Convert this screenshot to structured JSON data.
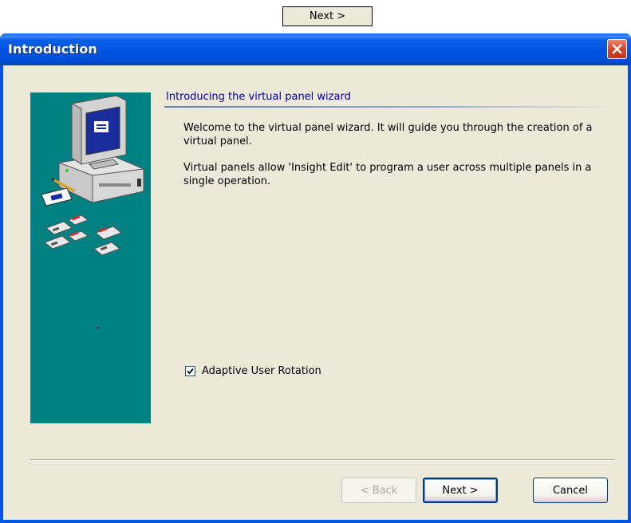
{
  "floating_button": {
    "label": "Next >"
  },
  "window": {
    "title": "Introduction"
  },
  "wizard": {
    "heading": "Introducing the virtual panel wizard",
    "paragraphs": [
      "Welcome to the virtual panel wizard. It will guide you through the creation of a virtual panel.",
      "Virtual panels allow 'Insight Edit' to program a user across multiple panels in a single operation."
    ],
    "checkbox": {
      "label": "Adaptive User Rotation",
      "checked": true
    }
  },
  "buttons": {
    "back": "< Back",
    "next": "Next >",
    "cancel": "Cancel"
  },
  "colors": {
    "side_panel": "#008080",
    "heading": "#0000a0",
    "titlebar": "#0054e3"
  }
}
